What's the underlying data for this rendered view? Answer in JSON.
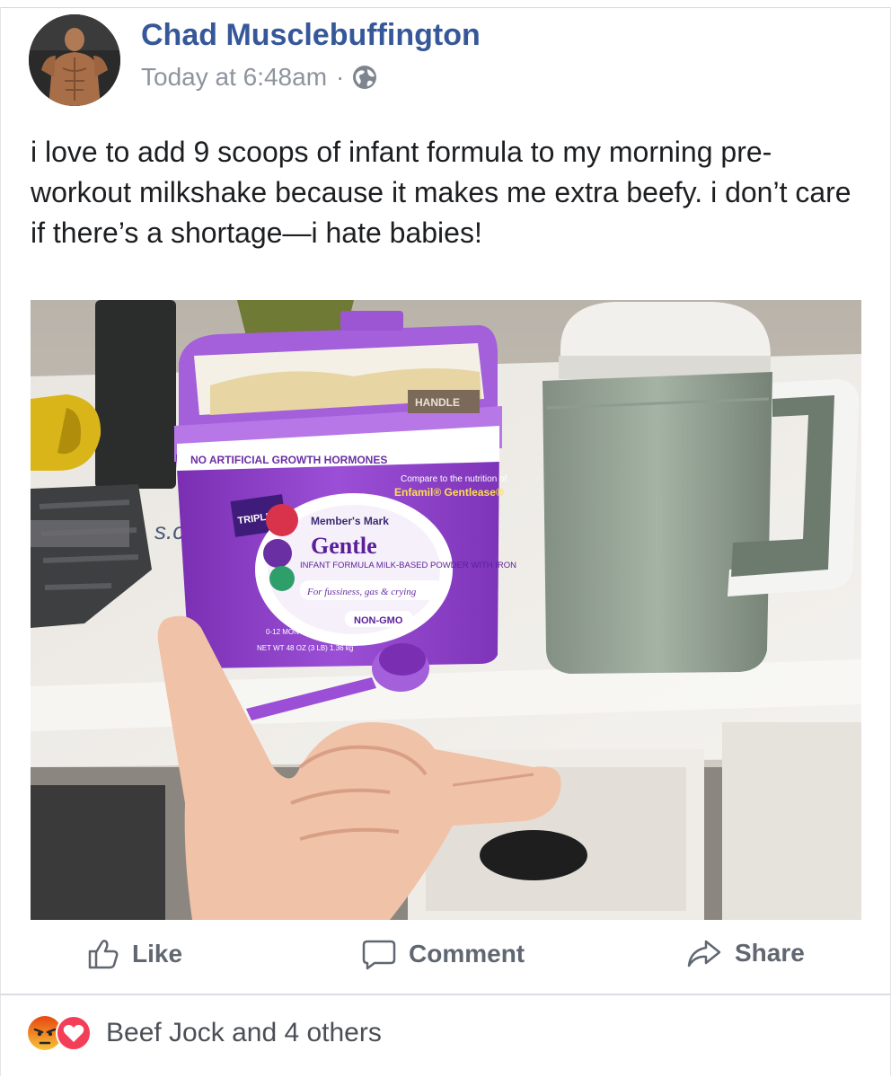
{
  "post": {
    "author": {
      "name": "Chad Musclebuffington",
      "avatar_icon": "avatar-photo"
    },
    "timestamp": "Today at 6:48am",
    "separator": "·",
    "privacy_icon": "globe-icon",
    "text": "i love to add 9 scoops of infant formula to my morning pre-workout milkshake because it makes me extra beefy. i don’t care if there’s a shortage—i hate babies!"
  },
  "photo": {
    "formula_tub": {
      "lid_label": "HANDLE",
      "banner": "NO ARTIFICIAL GROWTH HORMONES",
      "compare_text": "Compare to the nutrition of",
      "compare_brand": "Enfamil® Gentlease®",
      "badge": "TRIPLE CARE",
      "brand": "Member's Mark",
      "product": "Gentle",
      "description": "INFANT FORMULA MILK-BASED POWDER WITH IRON",
      "tagline": "For fussiness, gas & crying",
      "non_gmo": "NON-GMO",
      "age": "0-12 MONTHS",
      "net_weight": "NET WT 48 OZ (3 LB) 1.36 kg"
    },
    "watermark": "s.com"
  },
  "actions": [
    {
      "label": "Like",
      "icon": "thumbs-up-icon"
    },
    {
      "label": "Comment",
      "icon": "comment-icon"
    },
    {
      "label": "Share",
      "icon": "share-icon"
    }
  ],
  "reactions": {
    "icons": [
      "angry-icon",
      "love-icon"
    ],
    "summary": "Beef Jock and 4 others"
  },
  "colors": {
    "name_blue": "#365899",
    "meta_gray": "#8d949e",
    "action_gray": "#606770",
    "tub_purple": "#8e3fc4",
    "love_red": "#f33e58",
    "angry_orange": "#e9710f"
  }
}
